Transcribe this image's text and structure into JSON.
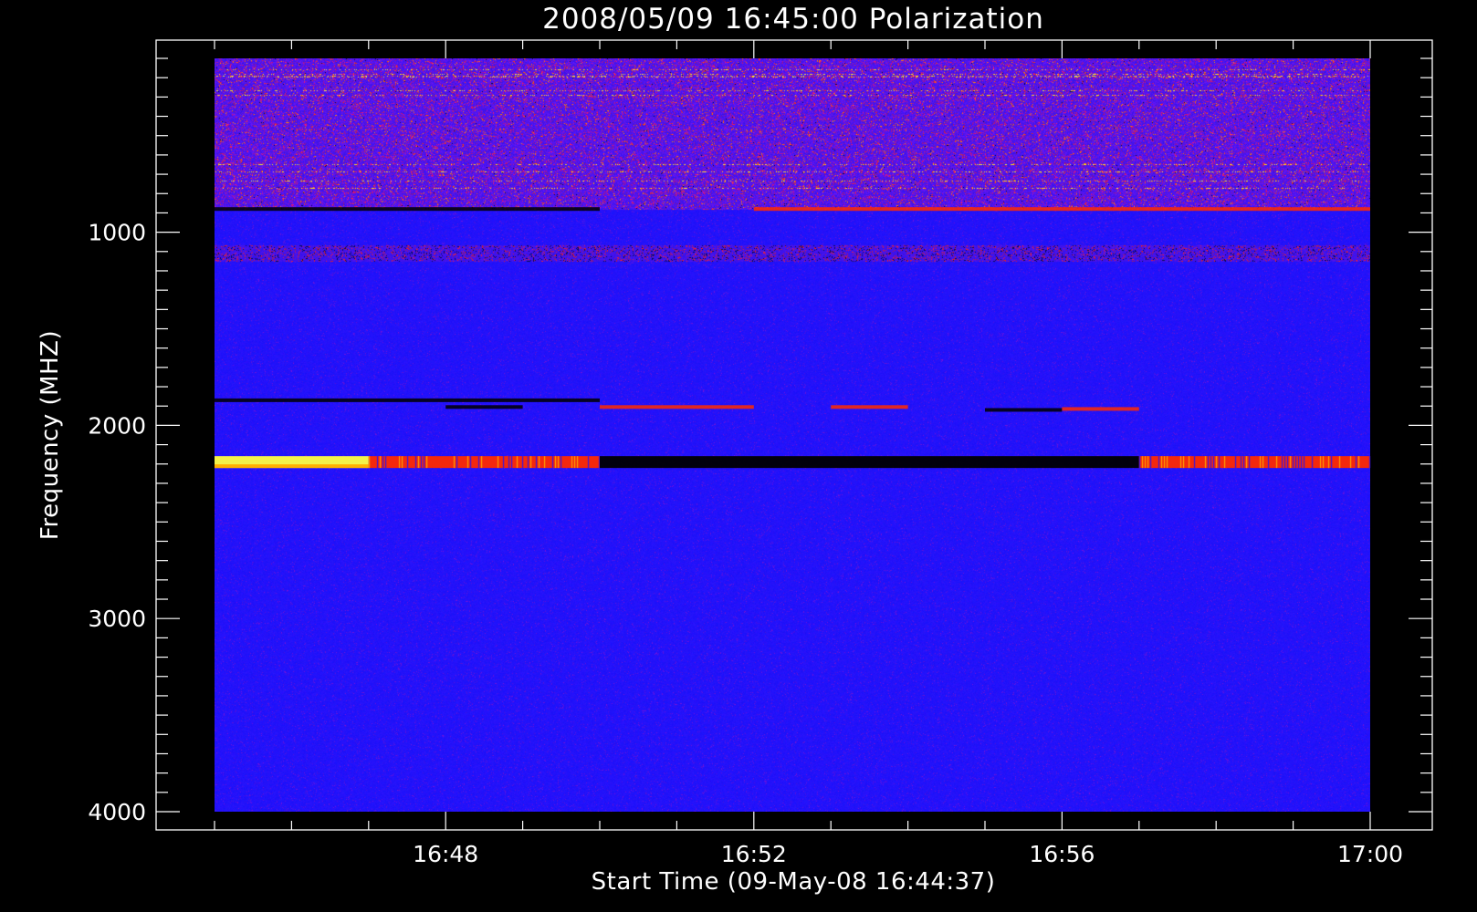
{
  "chart_data": {
    "type": "heatmap",
    "title": "2008/05/09 16:45:00 Polarization",
    "xlabel": "Start Time (09-May-08 16:44:37)",
    "ylabel": "Frequency (MHZ)",
    "xlim": [
      "16:45:00",
      "17:00:00"
    ],
    "ylim": [
      100,
      4000
    ],
    "y_inverted": true,
    "x_ticks": [
      "16:48",
      "16:52",
      "16:56",
      "17:00"
    ],
    "y_ticks": [
      "1000",
      "2000",
      "3000",
      "4000"
    ],
    "grid": false,
    "colormap": {
      "background": "#000000",
      "base": "#1e10ff",
      "levels": [
        "#000000",
        "#2a1f8a",
        "#1e10ff",
        "#8b1ad0",
        "#ff2000",
        "#ffb000",
        "#ffff40",
        "#ffffff"
      ]
    },
    "features": [
      {
        "name": "RFI band",
        "freq_mhz": [
          100,
          880
        ],
        "time": [
          "16:45:00",
          "17:00:00"
        ],
        "polarization": "mixed",
        "intensity": "strong"
      },
      {
        "name": "narrow line",
        "freq_mhz": 880,
        "time": [
          "16:45:00",
          "16:50:00"
        ],
        "polarization": "negative"
      },
      {
        "name": "narrow line",
        "freq_mhz": 880,
        "time": [
          "16:52:00",
          "17:00:00"
        ],
        "polarization": "positive"
      },
      {
        "name": "speckle row",
        "freq_mhz": 1110,
        "time": [
          "16:45:00",
          "17:00:00"
        ],
        "polarization": "mixed"
      },
      {
        "name": "line",
        "freq_mhz": 1870,
        "time": [
          "16:45:00",
          "16:50:00"
        ],
        "polarization": "negative"
      },
      {
        "name": "line",
        "freq_mhz": 1905,
        "time": [
          "16:48:00",
          "16:49:00"
        ],
        "polarization": "negative"
      },
      {
        "name": "line",
        "freq_mhz": 1905,
        "time": [
          "16:50:00",
          "16:52:00"
        ],
        "polarization": "positive"
      },
      {
        "name": "line",
        "freq_mhz": 1905,
        "time": [
          "16:53:00",
          "16:54:00"
        ],
        "polarization": "positive"
      },
      {
        "name": "line",
        "freq_mhz": 1920,
        "time": [
          "16:55:00",
          "16:56:00"
        ],
        "polarization": "negative"
      },
      {
        "name": "line",
        "freq_mhz": 1915,
        "time": [
          "16:56:00",
          "16:57:00"
        ],
        "polarization": "positive"
      },
      {
        "name": "strong band",
        "freq_mhz": 2190,
        "time": [
          "16:45:00",
          "16:47:00"
        ],
        "polarization": "positive",
        "intensity": "saturated"
      },
      {
        "name": "strong band",
        "freq_mhz": 2190,
        "time": [
          "16:47:00",
          "16:50:00"
        ],
        "polarization": "positive"
      },
      {
        "name": "strong band",
        "freq_mhz": 2190,
        "time": [
          "16:50:00",
          "16:57:00"
        ],
        "polarization": "negative"
      },
      {
        "name": "strong band",
        "freq_mhz": 2190,
        "time": [
          "16:57:00",
          "17:00:00"
        ],
        "polarization": "positive"
      }
    ]
  }
}
